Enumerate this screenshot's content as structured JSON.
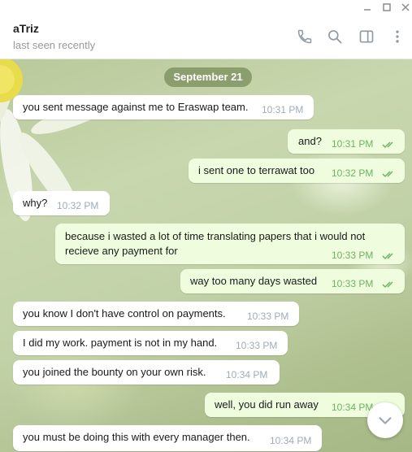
{
  "window": {
    "minimize_icon": "minimize-icon",
    "maximize_icon": "maximize-icon",
    "close_icon": "close-icon"
  },
  "header": {
    "peer_name": "aTriz",
    "peer_status": "last seen recently",
    "icons": [
      "phone-icon",
      "search-icon",
      "sidebar-panel-icon",
      "more-vertical-icon"
    ]
  },
  "chat": {
    "date_separator": "September 21",
    "messages": [
      {
        "direction": "in",
        "text": "you sent message against me to Eraswap team.",
        "time": "10:31 PM"
      },
      {
        "direction": "out",
        "text": "and?",
        "time": "10:31 PM",
        "status": "read"
      },
      {
        "direction": "out",
        "text": "i sent one to terrawat too",
        "time": "10:32 PM",
        "status": "read"
      },
      {
        "direction": "in",
        "text": "why?",
        "time": "10:32 PM"
      },
      {
        "direction": "out",
        "text_line1": "because i wasted a lot of time translating papers that i would not",
        "text_line2": "recieve any payment for",
        "time": "10:33 PM",
        "status": "read"
      },
      {
        "direction": "out",
        "text": "way too many days wasted",
        "time": "10:33 PM",
        "status": "read"
      },
      {
        "direction": "in",
        "text": "you know I don't have control on payments.",
        "time": "10:33 PM"
      },
      {
        "direction": "in",
        "text": "I did my work. payment is not in my hand.",
        "time": "10:33 PM"
      },
      {
        "direction": "in",
        "text": "you joined the bounty on your own risk.",
        "time": "10:34 PM"
      },
      {
        "direction": "out",
        "text": "well, you did run away",
        "time": "10:34 PM",
        "status": "read"
      },
      {
        "direction": "in",
        "text": "you must be doing this with every manager then.",
        "time": "10:34 PM"
      }
    ],
    "scroll_down_icon": "chevron-down-icon"
  },
  "colors": {
    "incoming_bubble": "#ffffff",
    "outgoing_bubble": "#effdde",
    "read_tick": "#6cb35f",
    "date_pill": "#7e9162"
  }
}
